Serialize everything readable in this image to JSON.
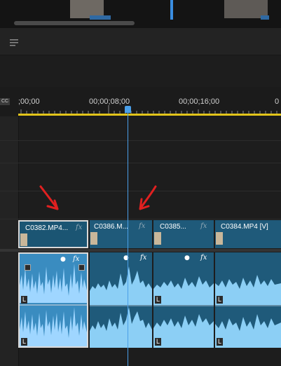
{
  "ruler": {
    "tc_start": ";00;00",
    "tc_8": "00;00;08;00",
    "tc_16": "00;00;16;00",
    "tc_24": "0",
    "cc_label": "CC"
  },
  "clips": {
    "c1": "C0382.MP4...",
    "c2": "C0386.M...",
    "c3": "C0385...",
    "c4": "C0384.MP4 [V]"
  },
  "fx_label": "fx",
  "audio_channel_label": "L",
  "colors": {
    "playhead": "#4a9fe8",
    "work_area": "#e2c41a",
    "video_clip": "#1f5a7a",
    "audio_clip": "#2c7fae",
    "waveform": "#9fd6ff",
    "annotation_arrow": "#e02020"
  },
  "icons": [
    "hamburger-icon",
    "speaker-icon",
    "volume-keyframe-icon",
    "film-thumbnail-icon"
  ]
}
